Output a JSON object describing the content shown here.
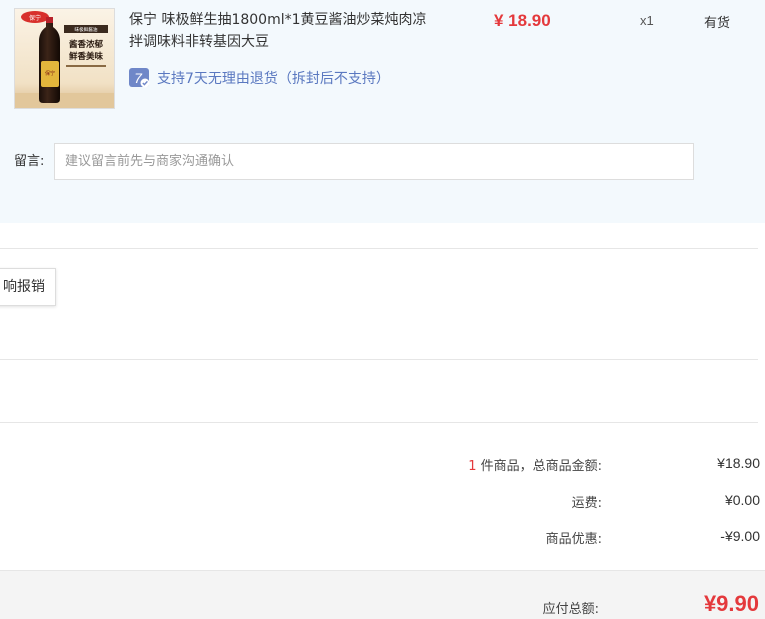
{
  "item": {
    "title": "保宁 味极鲜生抽1800ml*1黄豆酱油炒菜炖肉凉拌调味料非转基因大豆",
    "price": "¥ 18.90",
    "quantity": "x1",
    "stock_status": "有货",
    "return_policy": "支持7天无理由退货（拆封后不支持）",
    "return_icon_text": "7",
    "image": {
      "brand_logo": "保宁",
      "banner": "味极鲜酱油",
      "slogan_line1": "酱香浓郁",
      "slogan_line2": "鲜香美味",
      "bottle_label": "保宁"
    }
  },
  "message": {
    "label": "留言:",
    "placeholder": "建议留言前先与商家沟通确认"
  },
  "invoice_button": "响报销",
  "summary": {
    "count": "1",
    "count_suffix": " 件商品，总商品金额:",
    "goods_total": "¥18.90",
    "shipping_label": "运费:",
    "shipping_value": "¥0.00",
    "discount_label": "商品优惠:",
    "discount_value": "-¥9.00"
  },
  "total": {
    "label": "应付总额:",
    "value": "¥9.90"
  },
  "colors": {
    "accent_red": "#e4393c",
    "panel_bg": "#f3f9fd",
    "return_blue": "#5a78c0"
  }
}
